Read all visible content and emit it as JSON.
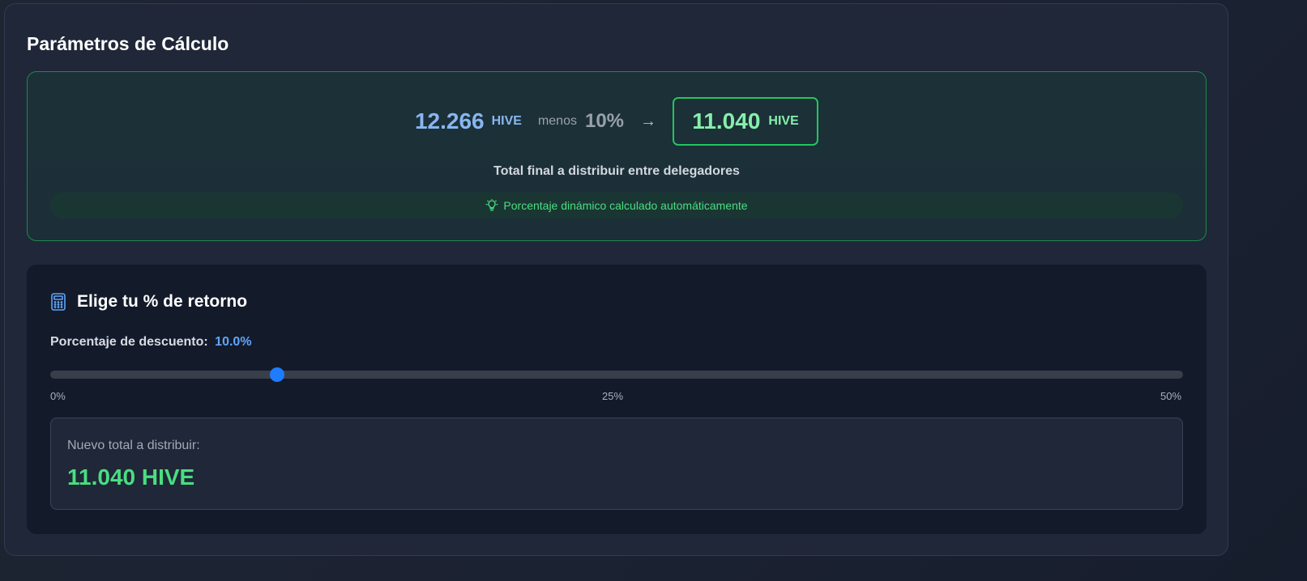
{
  "panel": {
    "title": "Parámetros de Cálculo"
  },
  "summary": {
    "original_amount": "12.266",
    "original_unit": "HIVE",
    "minus_label": "menos",
    "discount_percent": "10%",
    "arrow": "→",
    "final_amount": "11.040",
    "final_unit": "HIVE",
    "caption": "Total final a distribuir entre delegadores",
    "hint_icon": "lightbulb-icon",
    "hint_text": "Porcentaje dinámico calculado automáticamente"
  },
  "calculator": {
    "icon": "calculator-icon",
    "title": "Elige tu % de retorno",
    "slider_label": "Porcentaje de descuento:",
    "slider_value_text": "10.0%",
    "slider": {
      "min": 0,
      "max": 50,
      "value": 10.0
    },
    "ticks": [
      "0%",
      "25%",
      "50%"
    ],
    "result_label": "Nuevo total a distribuir:",
    "result_value": "11.040 HIVE"
  },
  "colors": {
    "accent_blue": "#60a5fa",
    "accent_green": "#4ade80",
    "border_green": "#22c55e",
    "slider_thumb": "#1f7cff"
  }
}
